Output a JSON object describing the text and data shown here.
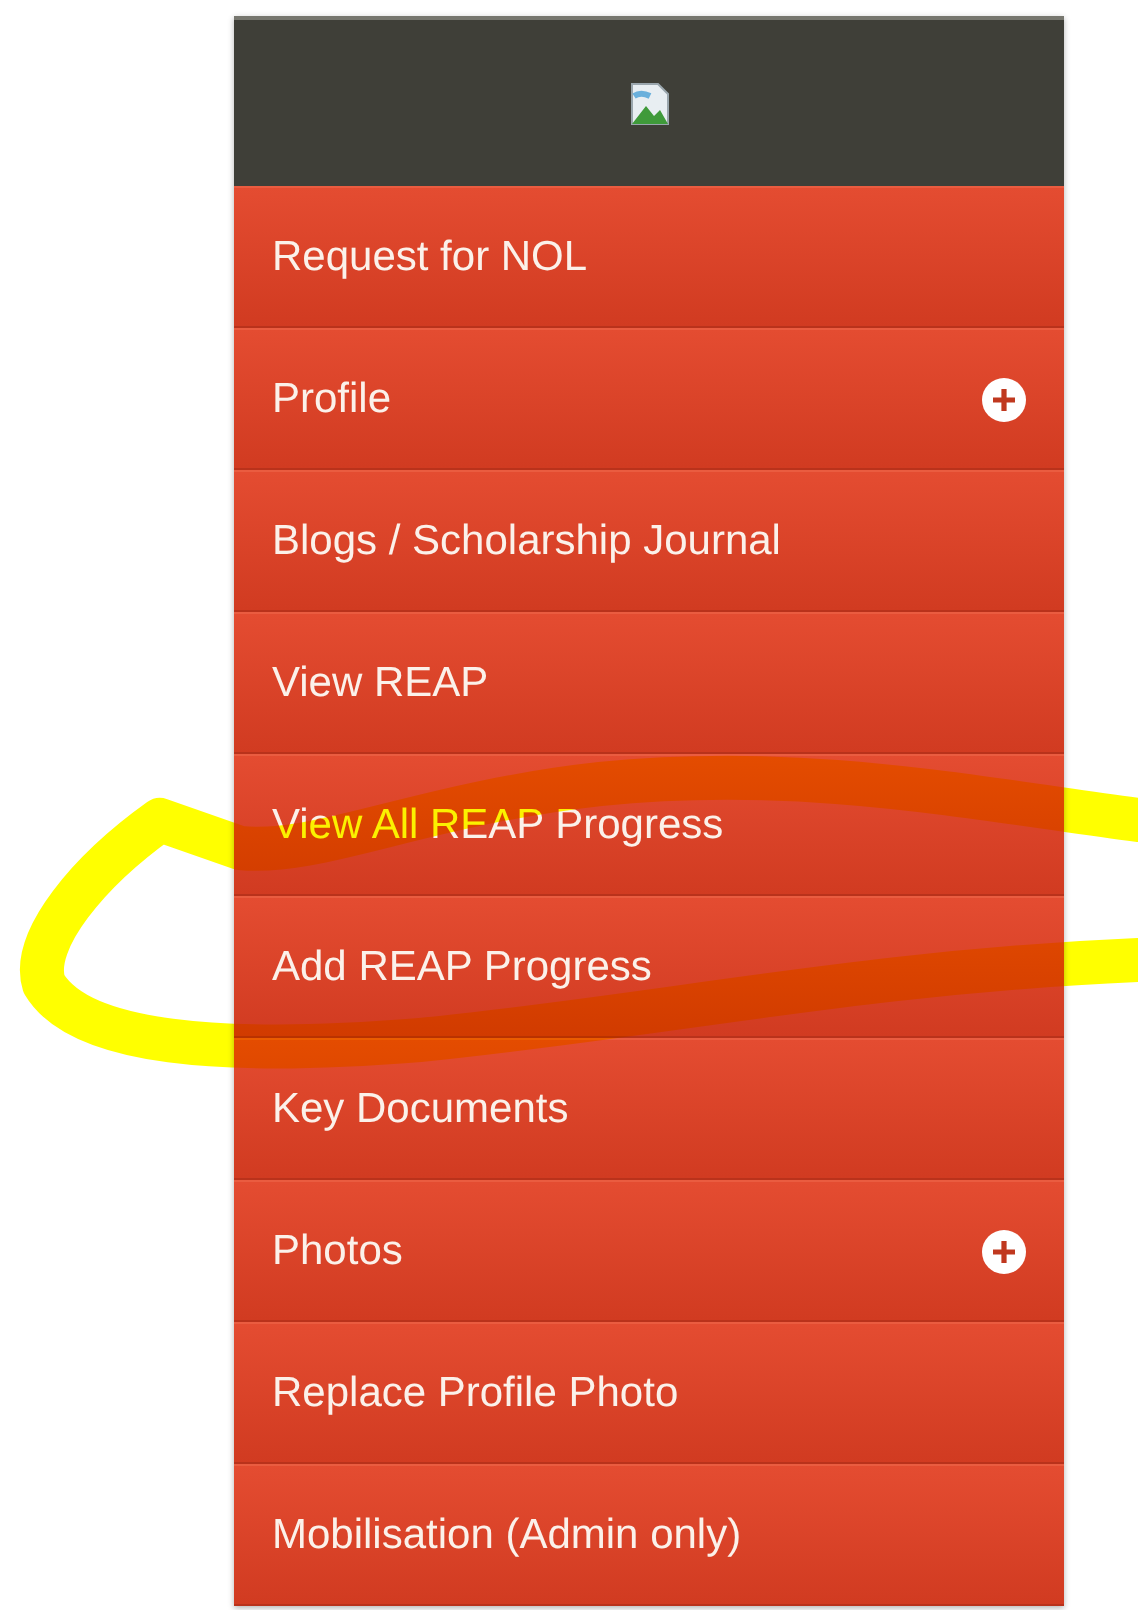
{
  "menu": {
    "items": [
      {
        "label": "Request for NOL",
        "expandable": false
      },
      {
        "label": "Profile",
        "expandable": true
      },
      {
        "label": "Blogs / Scholarship Journal",
        "expandable": false
      },
      {
        "label": "View REAP",
        "expandable": false
      },
      {
        "label": "View All REAP Progress",
        "expandable": false
      },
      {
        "label": "Add REAP Progress",
        "expandable": false
      },
      {
        "label": "Key Documents",
        "expandable": false
      },
      {
        "label": "Photos",
        "expandable": true
      },
      {
        "label": "Replace Profile Photo",
        "expandable": false
      },
      {
        "label": "Mobilisation (Admin only)",
        "expandable": false
      }
    ]
  }
}
